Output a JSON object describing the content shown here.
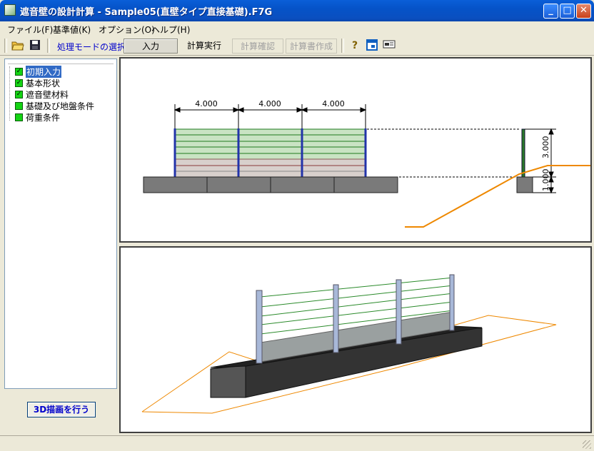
{
  "window": {
    "title": "遮音壁の設計計算 - Sample05(直壁タイプ直接基礎).F7G",
    "minimize": "_",
    "maximize": "□",
    "close": "✕"
  },
  "menu": [
    "ファイル(F)",
    "基準値(K)",
    "オプション(O)",
    "ヘルプ(H)"
  ],
  "toolbar": {
    "mode_label": "処理モードの選択",
    "modes": [
      "入力",
      "計算実行",
      "計算確認",
      "計算書作成"
    ],
    "active_mode": "入力",
    "disabled_modes": [
      "計算確認",
      "計算書作成"
    ]
  },
  "tree": [
    {
      "label": "初期入力",
      "checked": true,
      "selected": true
    },
    {
      "label": "基本形状",
      "checked": true,
      "selected": false
    },
    {
      "label": "遮音壁材料",
      "checked": true,
      "selected": false
    },
    {
      "label": "基礎及び地盤条件",
      "checked": false,
      "selected": false
    },
    {
      "label": "荷重条件",
      "checked": false,
      "selected": false
    }
  ],
  "button_3d": "3D描画を行う",
  "drawing": {
    "spans": [
      "4.000",
      "4.000",
      "4.000"
    ],
    "wall_height": "3.000",
    "footing_height": "1.000",
    "colors": {
      "panel": "#c9e3c3",
      "frame": "#1e7a1e",
      "post": "#2233aa",
      "footing": "#7a7a7a",
      "ground": "#ee8800"
    }
  }
}
